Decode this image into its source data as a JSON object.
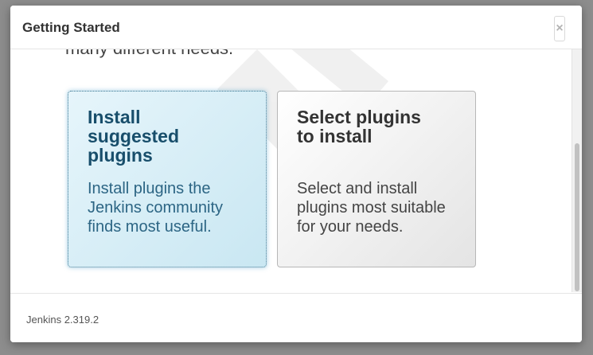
{
  "dialog": {
    "title": "Getting Started",
    "close_label": "×"
  },
  "body": {
    "intro_fragment": "many different needs."
  },
  "choices": [
    {
      "title": "Install suggested plugins",
      "description": "Install plugins the Jenkins community finds most useful.",
      "state": "highlighted"
    },
    {
      "title": "Select plugins to install",
      "description": "Select and install plugins most suitable for your needs.",
      "state": "normal"
    }
  ],
  "footer": {
    "version": "Jenkins 2.319.2"
  },
  "colors": {
    "highlight_border": "#3f7893",
    "highlight_text": "#184e6b"
  },
  "icons": {
    "watermark": "jenkins-logo-watermark"
  }
}
